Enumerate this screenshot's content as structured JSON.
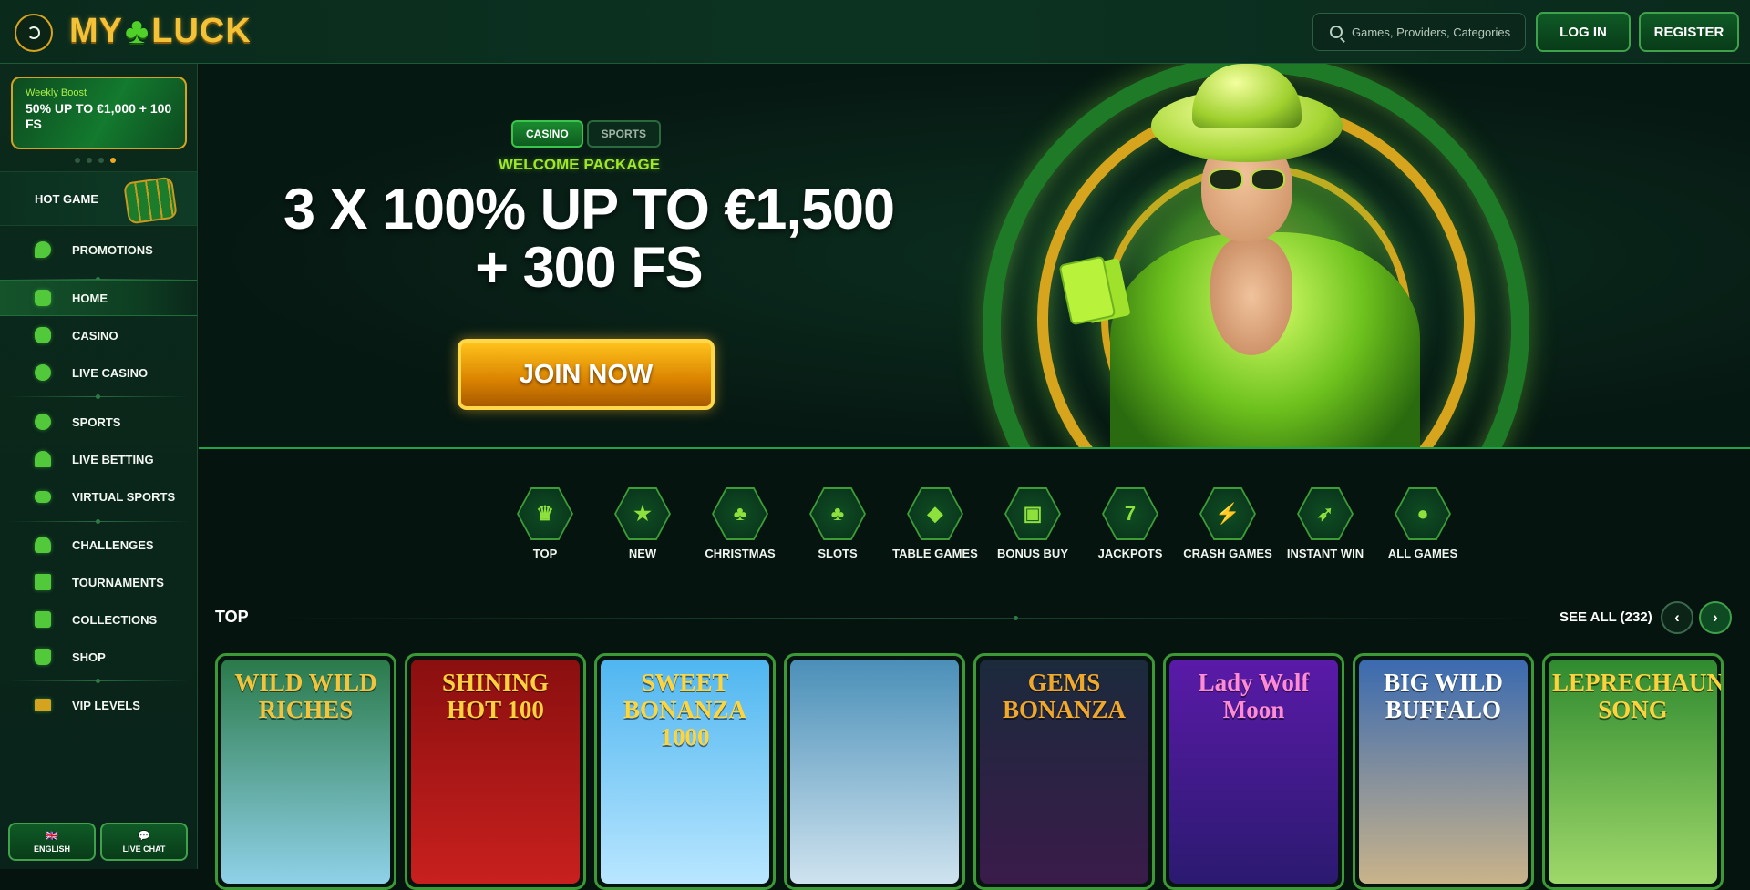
{
  "header": {
    "logo_left": "MY",
    "logo_clover": "♣",
    "logo_right": "LUCK",
    "search_placeholder": "Games, Providers, Categories",
    "login_label": "LOG IN",
    "register_label": "REGISTER"
  },
  "sidebar": {
    "boost_kicker": "Weekly Boost",
    "boost_title": "50% UP TO €1,000 + 100 FS",
    "hot_game_label": "HOT GAME",
    "items": [
      {
        "label": "PROMOTIONS",
        "icon": "flame-icon"
      },
      {
        "label": "HOME",
        "icon": "home-icon"
      },
      {
        "label": "CASINO",
        "icon": "clover-icon"
      },
      {
        "label": "LIVE CASINO",
        "icon": "chip-icon"
      },
      {
        "label": "SPORTS",
        "icon": "ball-icon"
      },
      {
        "label": "LIVE BETTING",
        "icon": "signal-icon"
      },
      {
        "label": "VIRTUAL SPORTS",
        "icon": "gamepad-icon"
      },
      {
        "label": "CHALLENGES",
        "icon": "medal-icon"
      },
      {
        "label": "TOURNAMENTS",
        "icon": "podium-icon"
      },
      {
        "label": "COLLECTIONS",
        "icon": "collection-icon"
      },
      {
        "label": "SHOP",
        "icon": "bag-icon"
      },
      {
        "label": "VIP LEVELS",
        "icon": "ticket-icon"
      }
    ],
    "language_label": "ENGLISH",
    "chat_label": "LIVE CHAT"
  },
  "hero": {
    "tab_casino": "CASINO",
    "tab_sports": "SPORTS",
    "welcome": "WELCOME PACKAGE",
    "headline_1": "3 X 100% UP TO €1,500",
    "headline_2": "+ 300 FS",
    "cta": "JOIN NOW"
  },
  "categories": [
    {
      "label": "TOP",
      "glyph": "♛"
    },
    {
      "label": "NEW",
      "glyph": "★"
    },
    {
      "label": "CHRISTMAS",
      "glyph": "♣"
    },
    {
      "label": "SLOTS",
      "glyph": "♣"
    },
    {
      "label": "TABLE GAMES",
      "glyph": "◆"
    },
    {
      "label": "BONUS BUY",
      "glyph": "▣"
    },
    {
      "label": "JACKPOTS",
      "glyph": "7"
    },
    {
      "label": "CRASH GAMES",
      "glyph": "⚡"
    },
    {
      "label": "INSTANT WIN",
      "glyph": "➶"
    },
    {
      "label": "ALL GAMES",
      "glyph": "●"
    }
  ],
  "top_section": {
    "title": "TOP",
    "see_all": "SEE ALL (232)",
    "prev": "‹",
    "next": "›"
  },
  "games": [
    {
      "title": "WILD WILD RICHES",
      "colors": [
        "#2a7a4a",
        "#8fd1e8"
      ],
      "text_color": "#f3c43b"
    },
    {
      "title": "SHINING HOT 100",
      "colors": [
        "#8a0f0f",
        "#c8201e"
      ],
      "text_color": "#ffd23d"
    },
    {
      "title": "SWEET BONANZA 1000",
      "colors": [
        "#4fb6f0",
        "#b9e6ff"
      ],
      "text_color": "#ffd53b"
    },
    {
      "title": "",
      "colors": [
        "#4a8fb8",
        "#cfe3ef"
      ],
      "text_color": "#ffffff"
    },
    {
      "title": "GEMS BONANZA",
      "colors": [
        "#1b2a3c",
        "#3a1b4a"
      ],
      "text_color": "#f0a82a"
    },
    {
      "title": "Lady Wolf Moon",
      "colors": [
        "#5a1aa8",
        "#2b1a70"
      ],
      "text_color": "#ff8cd2"
    },
    {
      "title": "BIG WILD BUFFALO",
      "colors": [
        "#3a6ab0",
        "#c9b38a"
      ],
      "text_color": "#ffffff"
    },
    {
      "title": "LEPRECHAUN SONG",
      "colors": [
        "#2f8a2f",
        "#9fd86a"
      ],
      "text_color": "#ffd23d"
    }
  ]
}
